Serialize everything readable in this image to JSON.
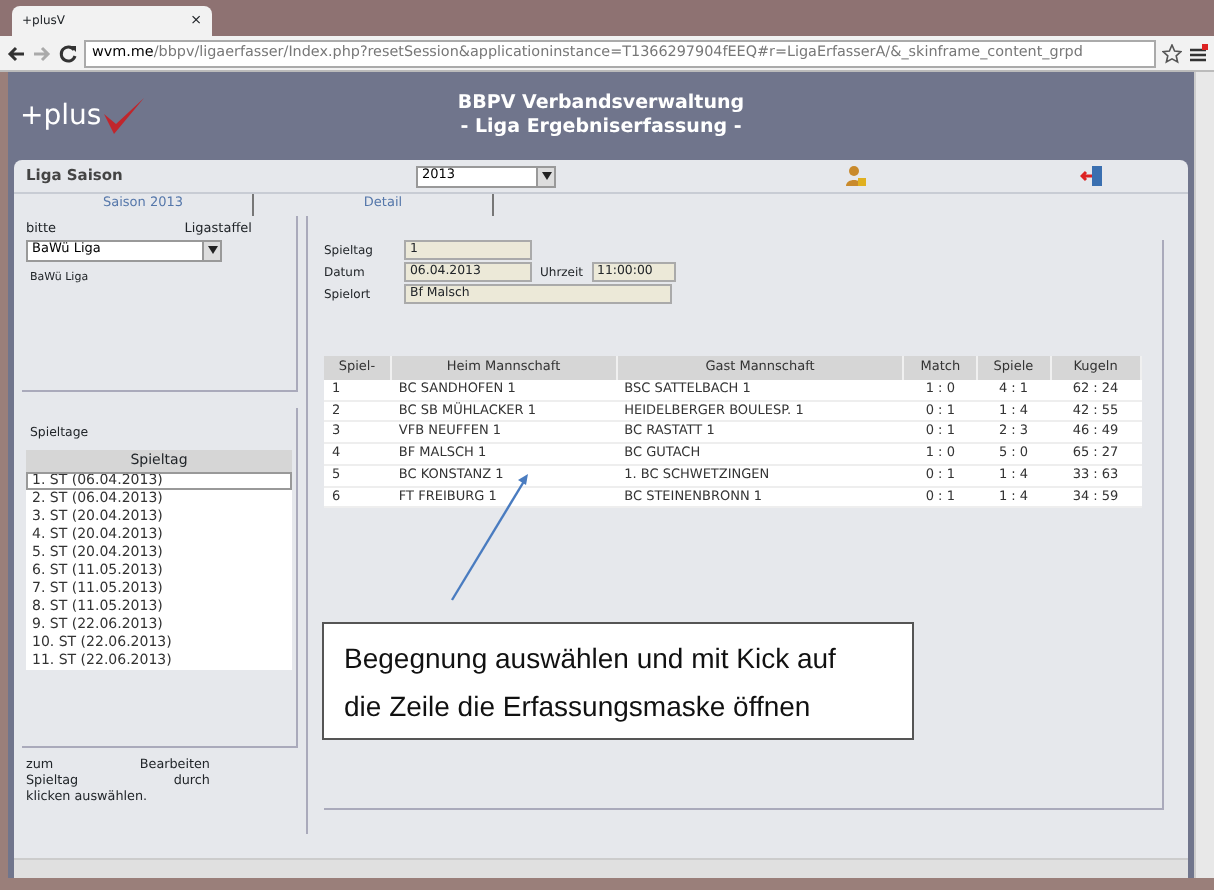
{
  "browser": {
    "tab_title": "+plusV",
    "tab_close": "×",
    "url_host": "wvm.me",
    "url_path": "/bbpv/ligaerfasser/Index.php?resetSession&applicationinstance=T1366297904fEEQ#r=LigaErfasserA/&_skinframe_content_grpd"
  },
  "header": {
    "logo": "+plus",
    "title_lines": [
      "BBPV Verbandsverwaltung",
      "- Liga Ergebniserfassung -"
    ]
  },
  "saison_bar": {
    "label": "Liga Saison",
    "season": "2013"
  },
  "tabs": [
    {
      "label": "Saison 2013"
    },
    {
      "label": "Detail"
    }
  ],
  "left": {
    "label_bitte": "bitte",
    "label_ligastaffel": "Ligastaffel",
    "staffel": "BaWü Liga",
    "staffel_name": "BaWü Liga",
    "spieltage_title": "Spieltage",
    "spieltage_header": "Spieltag",
    "spieltage": [
      {
        "label": "1. ST (06.04.2013)",
        "selected": true
      },
      {
        "label": "2. ST (06.04.2013)",
        "selected": false
      },
      {
        "label": "3. ST (20.04.2013)",
        "selected": false
      },
      {
        "label": "4. ST (20.04.2013)",
        "selected": false
      },
      {
        "label": "5. ST (20.04.2013)",
        "selected": false
      },
      {
        "label": "6. ST (11.05.2013)",
        "selected": false
      },
      {
        "label": "7. ST (11.05.2013)",
        "selected": false
      },
      {
        "label": "8. ST (11.05.2013)",
        "selected": false
      },
      {
        "label": "9. ST (22.06.2013)",
        "selected": false
      },
      {
        "label": "10. ST (22.06.2013)",
        "selected": false
      },
      {
        "label": "11. ST (22.06.2013)",
        "selected": false
      }
    ],
    "hint_words": [
      "zum",
      "Bearbeiten",
      "Spieltag",
      "durch",
      "klicken auswählen."
    ]
  },
  "detail": {
    "spieltag_label": "Spieltag",
    "spieltag": "1",
    "datum_label": "Datum",
    "datum": "06.04.2013",
    "uhrzeit_label": "Uhrzeit",
    "uhrzeit": "11:00:00",
    "spielort_label": "Spielort",
    "spielort": "Bf Malsch"
  },
  "table": {
    "columns": [
      "Spiel-",
      "Heim Mannschaft",
      "Gast Mannschaft",
      "Match",
      "Spiele",
      "Kugeln"
    ],
    "rows": [
      [
        "1",
        "BC SANDHOFEN 1",
        "BSC SATTELBACH 1",
        "1 : 0",
        "4 : 1",
        "62 : 24"
      ],
      [
        "2",
        "BC SB MÜHLACKER 1",
        "HEIDELBERGER BOULESP. 1",
        "0 : 1",
        "1 : 4",
        "42 : 55"
      ],
      [
        "3",
        "VFB NEUFFEN 1",
        "BC RASTATT 1",
        "0 : 1",
        "2 : 3",
        "46 : 49"
      ],
      [
        "4",
        "BF MALSCH 1",
        "BC GUTACH",
        "1 : 0",
        "5 : 0",
        "65 : 27"
      ],
      [
        "5",
        "BC KONSTANZ 1",
        "1. BC SCHWETZINGEN",
        "0 : 1",
        "1 : 4",
        "33 : 63"
      ],
      [
        "6",
        "FT FREIBURG 1",
        "BC STEINENBRONN 1",
        "0 : 1",
        "1 : 4",
        "34 : 59"
      ]
    ]
  },
  "callout": {
    "lines": [
      "Begegnung auswählen und mit Kick auf",
      "die Zeile die Erfassungsmaske öffnen"
    ]
  }
}
